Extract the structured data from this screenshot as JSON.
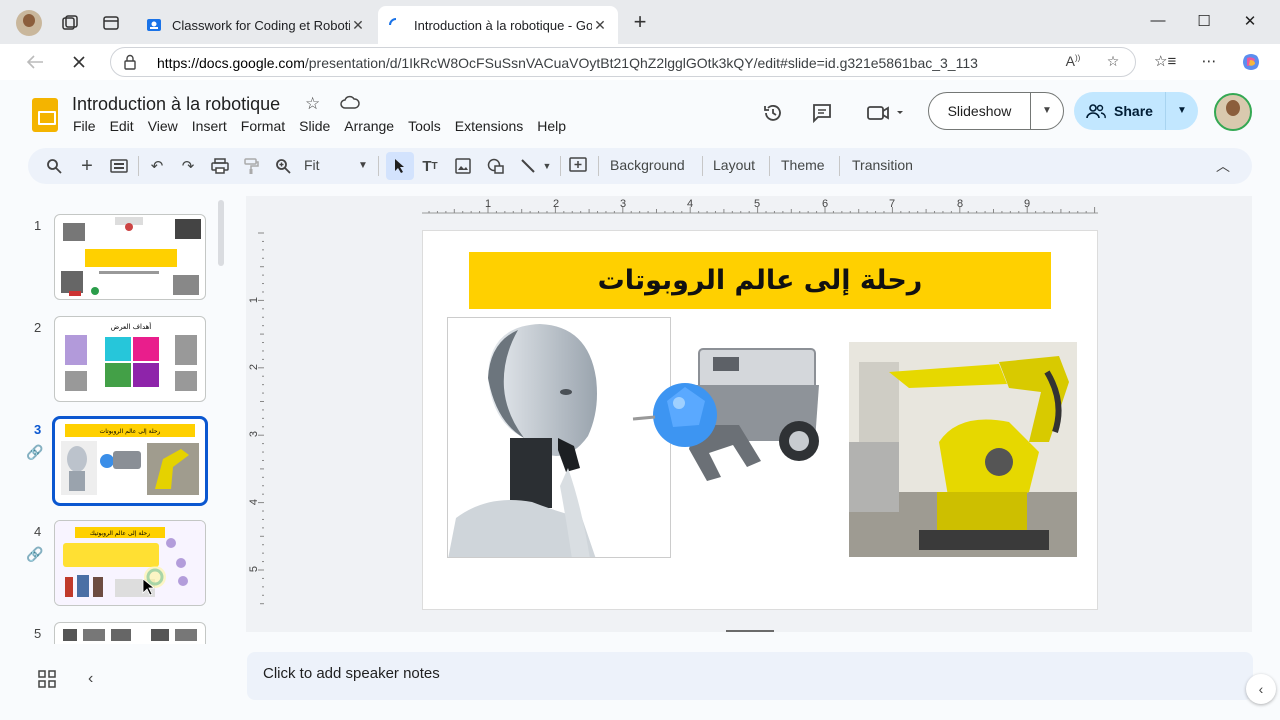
{
  "browser": {
    "tabs": [
      {
        "title": "Classwork for Coding et Robotique",
        "active": false
      },
      {
        "title": "Introduction à la robotique - Google",
        "active": true
      }
    ],
    "url_host": "https://docs.google.com",
    "url_path": "/presentation/d/1IkRcW8OcFSuSsnVACuaVOytBt21QhZ2lgglGOtk3kQY/edit#slide=id.g321e5861bac_3_113"
  },
  "doc": {
    "title": "Introduction à la robotique",
    "menus": [
      "File",
      "Edit",
      "View",
      "Insert",
      "Format",
      "Slide",
      "Arrange",
      "Tools",
      "Extensions",
      "Help"
    ],
    "slideshow_label": "Slideshow",
    "share_label": "Share"
  },
  "toolbar": {
    "zoom": "Fit",
    "background": "Background",
    "layout": "Layout",
    "theme": "Theme",
    "transition": "Transition"
  },
  "filmstrip": {
    "slides": [
      {
        "number": "1"
      },
      {
        "number": "2",
        "thumb_title": "أهداف العرض"
      },
      {
        "number": "3",
        "selected": true,
        "thumb_title": "رحلة إلى عالم الروبوتات"
      },
      {
        "number": "4",
        "thumb_title": "رحلة إلى عالم الروبوتيك"
      },
      {
        "number": "5"
      }
    ]
  },
  "rulers": {
    "top": [
      "1",
      "2",
      "3",
      "4",
      "5",
      "6",
      "7",
      "8",
      "9"
    ],
    "left": [
      "1",
      "2",
      "3",
      "4",
      "5"
    ]
  },
  "slide": {
    "title": "رحلة إلى عالم الروبوتات",
    "title_color": "#ffd000"
  },
  "notes": {
    "placeholder": "Click to add speaker notes"
  },
  "colors": {
    "accent": "#0b57d0",
    "share_bg": "#c2e7ff",
    "toolbar_bg": "#edf2fa"
  }
}
